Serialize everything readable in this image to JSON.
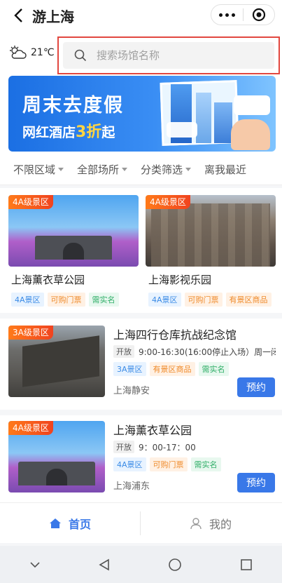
{
  "header": {
    "title": "游上海"
  },
  "weather": {
    "temp": "21℃"
  },
  "search": {
    "placeholder": "搜索场馆名称"
  },
  "banner": {
    "title": "周末去度假",
    "subtitle_prefix": "网红酒店",
    "subtitle_highlight": "3折",
    "subtitle_suffix": "起"
  },
  "filters": [
    {
      "label": "不限区域"
    },
    {
      "label": "全部场所"
    },
    {
      "label": "分类筛选"
    },
    {
      "label": "离我最近"
    }
  ],
  "grid_cards": [
    {
      "badge": "4A级景区",
      "name": "上海薰衣草公园",
      "tags": [
        "4A景区",
        "可购门票",
        "需实名"
      ]
    },
    {
      "badge": "4A级景区",
      "name": "上海影视乐园",
      "tags": [
        "4A景区",
        "可购门票",
        "有景区商品"
      ]
    }
  ],
  "list_items": [
    {
      "badge": "3A级景区",
      "name": "上海四行仓库抗战纪念馆",
      "open_label": "开放",
      "hours": "9:00-16:30(16:00停止入场）周一闭…",
      "tags": [
        "3A景区",
        "有景区商品",
        "需实名"
      ],
      "location": "上海静安",
      "action": "预约"
    },
    {
      "badge": "4A级景区",
      "name": "上海薰衣草公园",
      "open_label": "开放",
      "hours": "9：00-17：00",
      "tags": [
        "4A景区",
        "可购门票",
        "需实名"
      ],
      "location": "上海浦东",
      "action": "预约"
    }
  ],
  "tabbar": {
    "home": "首页",
    "mine": "我的"
  }
}
